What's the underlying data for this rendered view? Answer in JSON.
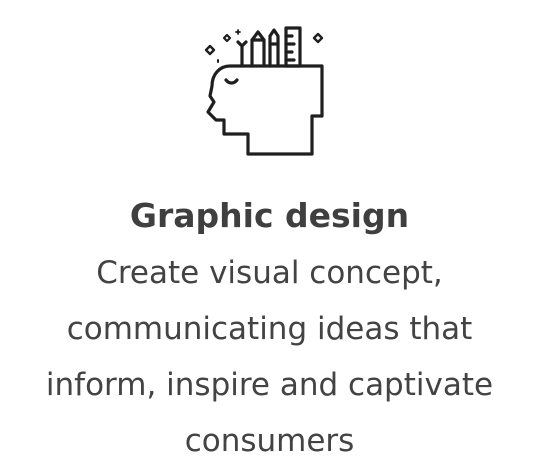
{
  "card": {
    "icon": "head-with-pencils-icon",
    "title": "Graphic design",
    "description_lines": [
      "Create visual concept,",
      "communicating ideas that",
      "inform, inspire and captivate",
      "consumers"
    ]
  },
  "colors": {
    "icon_stroke": "#1f1f1f",
    "title": "#3f3f3f",
    "text": "#434343",
    "background": "#ffffff"
  }
}
